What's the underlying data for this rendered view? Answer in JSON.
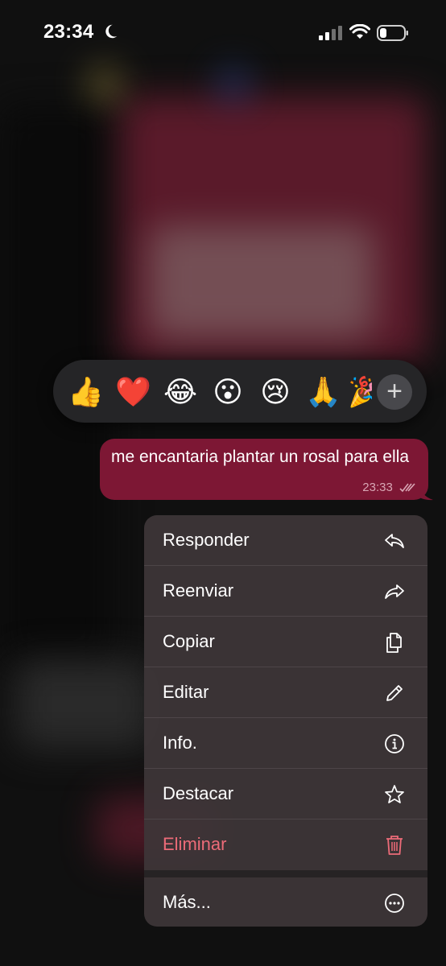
{
  "status_bar": {
    "time": "23:34",
    "moon_icon": "moon-icon",
    "signal_icon": "cellular-signal-icon",
    "wifi_icon": "wifi-icon",
    "battery_icon": "battery-low-icon"
  },
  "reactions": {
    "emojis": [
      "👍",
      "❤️",
      "😂",
      "😮",
      "😢",
      "🙏",
      "🎉"
    ],
    "more_label": "+"
  },
  "message": {
    "text": "me encantaria plantar un rosal para ella",
    "time": "23:33",
    "status_icon": "double-check-icon"
  },
  "menu": {
    "items": [
      {
        "label": "Responder",
        "icon": "reply-icon"
      },
      {
        "label": "Reenviar",
        "icon": "forward-icon"
      },
      {
        "label": "Copiar",
        "icon": "copy-icon"
      },
      {
        "label": "Editar",
        "icon": "pencil-icon"
      },
      {
        "label": "Info.",
        "icon": "info-icon"
      },
      {
        "label": "Destacar",
        "icon": "star-icon"
      },
      {
        "label": "Eliminar",
        "icon": "trash-icon"
      }
    ],
    "more": {
      "label": "Más...",
      "icon": "ellipsis-circle-icon"
    }
  },
  "colors": {
    "bubble": "#7d1734",
    "danger": "#ec6b78",
    "menu_bg": "#3e3638",
    "reaction_bar": "#252527"
  }
}
